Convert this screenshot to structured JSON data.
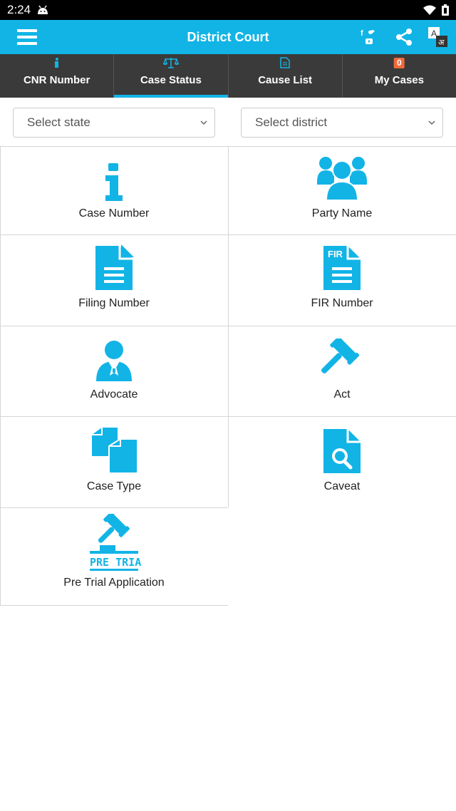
{
  "status": {
    "time": "2:24"
  },
  "app_bar": {
    "title": "District Court"
  },
  "tabs": [
    {
      "label": "CNR Number"
    },
    {
      "label": "Case Status"
    },
    {
      "label": "Cause List"
    },
    {
      "label": "My Cases",
      "badge": "0"
    }
  ],
  "selects": {
    "state": {
      "value": "Select state"
    },
    "district": {
      "value": "Select district"
    }
  },
  "tiles": [
    {
      "label": "Case Number"
    },
    {
      "label": "Party Name"
    },
    {
      "label": "Filing Number"
    },
    {
      "label": "FIR Number"
    },
    {
      "label": "Advocate"
    },
    {
      "label": "Act"
    },
    {
      "label": "Case Type"
    },
    {
      "label": "Caveat"
    },
    {
      "label": "Pre Trial Application",
      "icon_text": "PRE TRIAL"
    }
  ],
  "fir_icon_text": "FIR",
  "translate_icon_text": {
    "a": "A",
    "b": "अ"
  },
  "colors": {
    "accent": "#12b4e6",
    "tab_bg": "#3a3a3a",
    "badge": "#f06a3a"
  }
}
